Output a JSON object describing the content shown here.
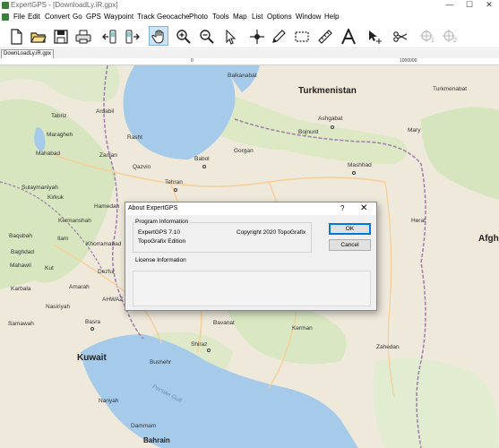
{
  "window": {
    "title": "ExpertGPS - [DownloadLy.iR.gpx]",
    "minimize": "—",
    "maximize": "☐",
    "close": "✕"
  },
  "menu": [
    "File",
    "Edit",
    "Convert",
    "Go",
    "GPS",
    "Waypoint",
    "Track",
    "Geocache",
    "Photo",
    "Tools",
    "Map",
    "List",
    "Options",
    "Window",
    "Help"
  ],
  "toolbar": {
    "icons": [
      "new-file-icon",
      "open-folder-icon",
      "save-icon",
      "print-icon",
      "receive-from-gps-icon",
      "send-to-gps-icon",
      "hand-pan-icon",
      "zoom-in-icon",
      "zoom-out-icon",
      "select-arrow-icon",
      "add-waypoint-icon",
      "pencil-icon",
      "select-rectangle-icon",
      "ruler-icon",
      "text-icon",
      "move-icon",
      "scissors-icon",
      "target-1-icon",
      "target-2-icon"
    ],
    "subscripts": {
      "first": "1",
      "second": "2"
    },
    "active": "hand-pan-icon"
  },
  "tab": {
    "label": "DownLoadLy.iR.gpx"
  },
  "ruler": {
    "zero": "0",
    "max": "1000000"
  },
  "map": {
    "regions": [
      "Turkmenistan",
      "Kuwait",
      "Afgh"
    ],
    "water_labels": [
      "Persian Gulf"
    ],
    "cities": [
      "Balkanabat",
      "Turkmenabat",
      "Ashgabat",
      "Mary",
      "Tabriz",
      "Ardabil",
      "Maragheh",
      "Rasht",
      "Bojnurd",
      "Mahabad",
      "Zanjan",
      "Qazvin",
      "Babol",
      "Gorgan",
      "Mashhad",
      "Sulaymaniyah",
      "Tehran",
      "Kirkuk",
      "Hamedan",
      "Kermanshah",
      "Herat",
      "Baqubah",
      "Ilam",
      "Khorramabad",
      "Baghdad",
      "Mahawil",
      "Kut",
      "Dezful",
      "Karbala",
      "Amarah",
      "AHWAZ",
      "Samawah",
      "Nasiriyah",
      "Bavanat",
      "Kerman",
      "Basra",
      "Shiraz",
      "Zahedan",
      "Bushehr",
      "Nariyah",
      "Dammam",
      "Bahrain"
    ],
    "colors": {
      "water": "#a6cbea",
      "land": "#efe9db",
      "green": "#cfe2b3",
      "border": "#a07cae",
      "road": "#f6cf9a"
    }
  },
  "dialog": {
    "title": "About ExpertGPS",
    "help": "?",
    "close": "✕",
    "program_info_title": "Program Information",
    "product": "ExpertGPS 7.10",
    "edition": "TopoGrafix Edition",
    "copyright": "Copyright 2020 TopoGrafix",
    "license_info_title": "License Information",
    "ok_label": "OK",
    "cancel_label": "Cancel"
  }
}
